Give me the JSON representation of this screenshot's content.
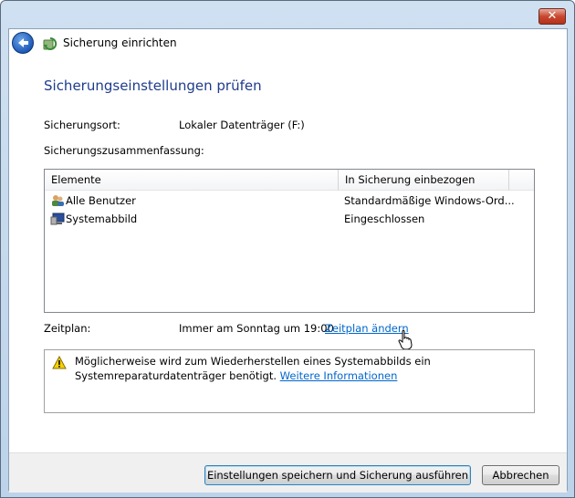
{
  "window": {
    "close_symbol": "✕"
  },
  "header": {
    "title": "Sicherung einrichten"
  },
  "page": {
    "title": "Sicherungseinstellungen prüfen"
  },
  "settings": {
    "location_label": "Sicherungsort:",
    "location_value": "Lokaler Datenträger (F:)",
    "summary_label": "Sicherungszusammenfassung:"
  },
  "table": {
    "columns": [
      "Elemente",
      "In Sicherung einbezogen"
    ],
    "rows": [
      {
        "icon": "users-icon",
        "item": "Alle Benutzer",
        "included": "Standardmäßige Windows-Ord..."
      },
      {
        "icon": "system-image-icon",
        "item": "Systemabbild",
        "included": "Eingeschlossen"
      }
    ]
  },
  "schedule": {
    "label": "Zeitplan:",
    "value": "Immer am Sonntag um 19:00",
    "change_link": "Zeitplan ändern"
  },
  "info": {
    "icon": "warning-icon",
    "text": "Möglicherweise wird zum Wiederherstellen eines Systemabbilds ein Systemreparaturdatenträger benötigt.",
    "link": "Weitere Informationen"
  },
  "buttons": {
    "save_run": "Einstellungen speichern und Sicherung ausführen",
    "cancel": "Abbrechen"
  }
}
